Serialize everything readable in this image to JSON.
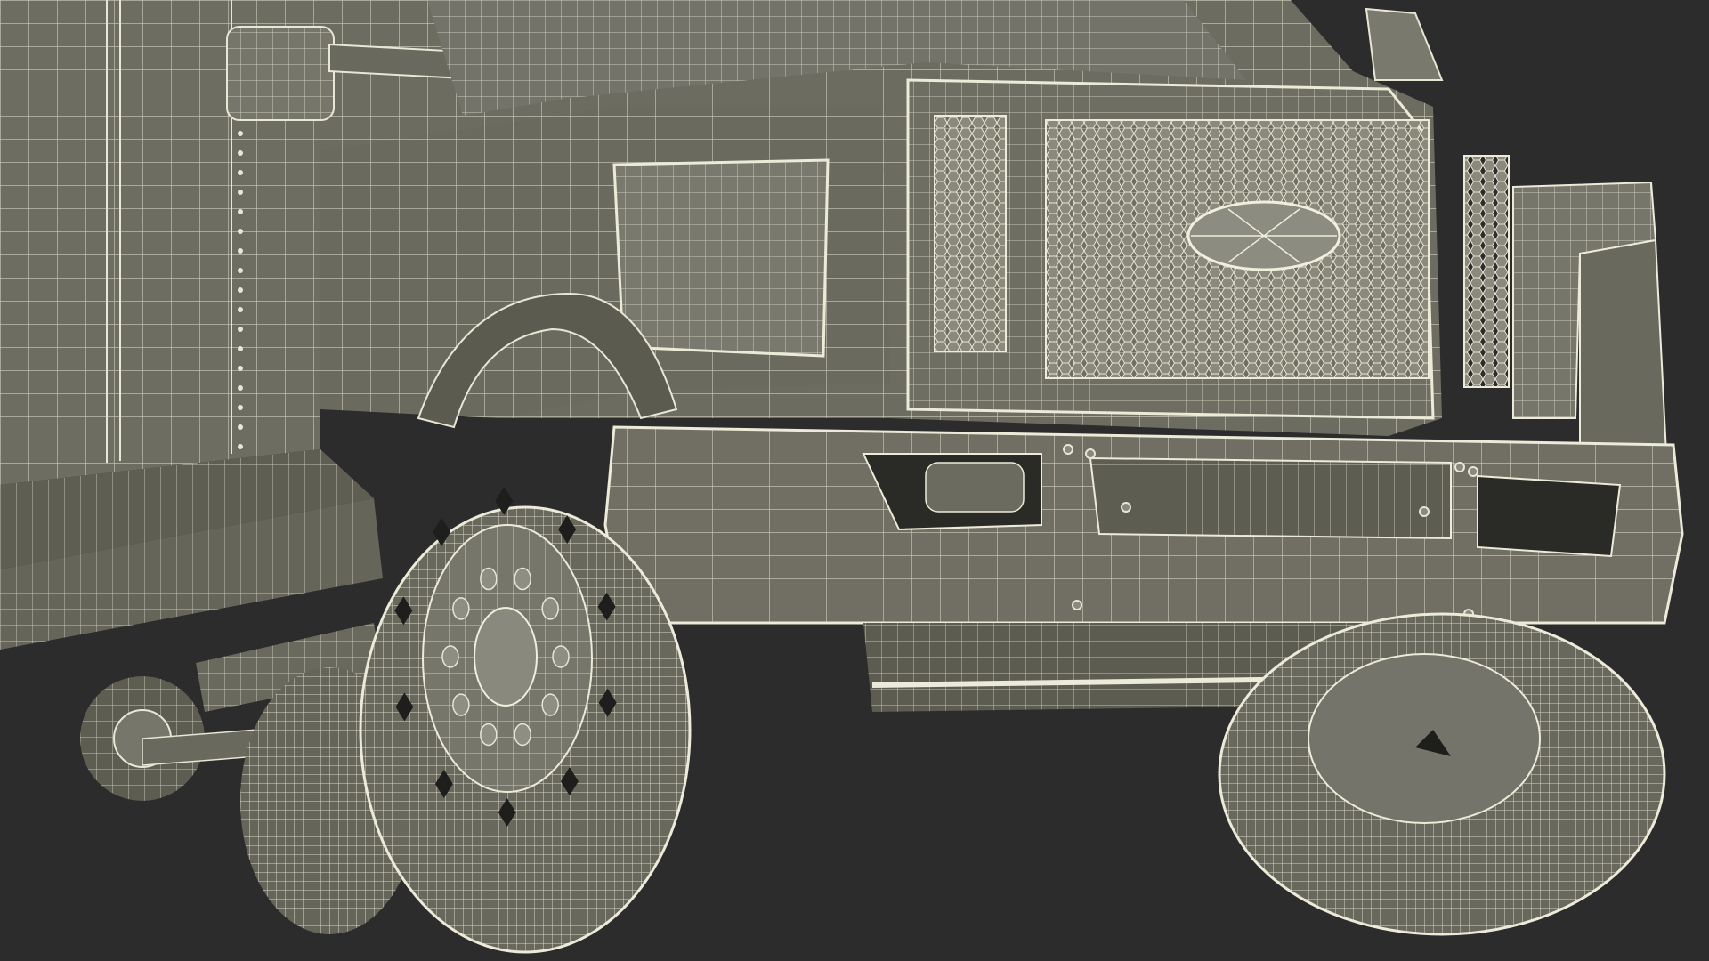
{
  "scene": {
    "subject": "",
    "background_color": "#2c2c2c",
    "body_fill_color": "#6f6e62",
    "wire_color": "#e8e6d4",
    "dark_hole_color": "#1e1e1c"
  }
}
